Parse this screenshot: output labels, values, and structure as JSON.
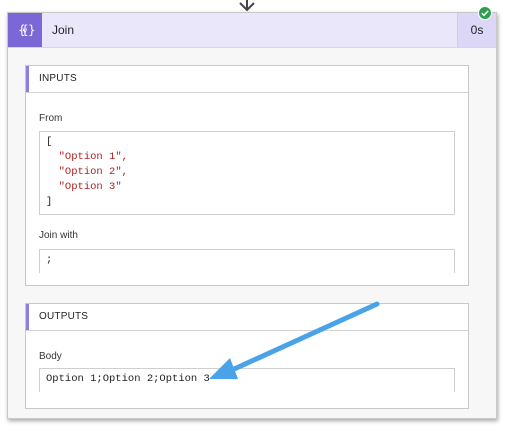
{
  "action": {
    "title": "Join",
    "duration": "0s",
    "icon": "variable-braces-icon",
    "status": "succeeded-check-icon",
    "accent_color": "#7b68d6"
  },
  "inputs": {
    "heading": "INPUTS",
    "from": {
      "label": "From",
      "open_bracket": "[",
      "items": [
        "\"Option 1\",",
        "\"Option 2\",",
        "\"Option 3\""
      ],
      "close_bracket": "]"
    },
    "join_with": {
      "label": "Join with",
      "value": ";"
    }
  },
  "outputs": {
    "heading": "OUTPUTS",
    "body": {
      "label": "Body",
      "value": "Option 1;Option 2;Option 3"
    }
  },
  "annotation": {
    "arrow_color": "#4aa3e8"
  }
}
